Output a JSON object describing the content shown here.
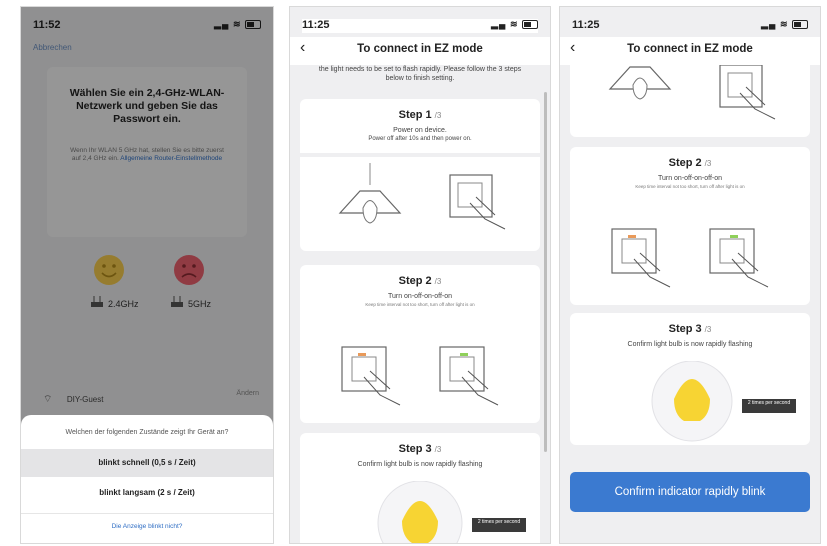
{
  "screens": [
    {
      "status_time": "11:52",
      "top_label": "Abbrechen",
      "card_title": "Wählen Sie ein 2,4-GHz-WLAN-Netzwerk und geben Sie das Passwort ein.",
      "card_hint": "Wenn Ihr WLAN 5 GHz hat, stellen Sie es bitte zuerst auf 2,4 GHz ein.",
      "card_link": "Allgemeine Router-Einstellmethode",
      "band_24": "2.4GHz",
      "band_5": "5GHz",
      "wifi_name": "DIY-Guest",
      "wifi_change": "Ändern",
      "sheet_question": "Welchen der folgenden Zustände zeigt Ihr Gerät an?",
      "options": [
        "blinkt schnell   (0,5 s / Zeit)",
        "blinkt langsam   (2 s / Zeit)"
      ],
      "selected_option": 0,
      "sheet_link": "Die Anzeige blinkt nicht?"
    },
    {
      "status_time": "11:25",
      "title": "To connect in EZ mode",
      "intro": "the light needs to be set to flash rapidly. Please follow the 3 steps below to finish setting.",
      "step1_title": "Step 1",
      "step1_count": "/3",
      "step1_line1": "Power on device.",
      "step1_line2": "Power off after 10s and then power on.",
      "step2_title": "Step 2",
      "step2_count": "/3",
      "step2_line1": "Turn on-off-on-off-on",
      "step2_tiny": "Keep time interval not too short, turn off after light is on",
      "step3_title": "Step 3",
      "step3_count": "/3",
      "step3_line1": "Confirm light bulb is now rapidly flashing",
      "badge": "2 times per second"
    },
    {
      "status_time": "11:25",
      "title": "To connect in EZ mode",
      "step2_title": "Step 2",
      "step2_count": "/3",
      "step2_line1": "Turn on-off-on-off-on",
      "step2_tiny": "Keep time interval not too short, turn off after light is on",
      "step3_title": "Step 3",
      "step3_count": "/3",
      "step3_line1": "Confirm light bulb is now rapidly flashing",
      "badge": "2 times per second",
      "confirm_button": "Confirm indicator rapidly blink"
    }
  ],
  "colors": {
    "accent_blue": "#3b7ad0",
    "bulb_yellow": "#f7d433",
    "switch_orange": "#e99a5a",
    "switch_green": "#8fd05a",
    "happy_face": "#f2c94c",
    "sad_face": "#e8606c"
  },
  "icons": [
    "back-chevron-icon",
    "wifi-icon",
    "battery-icon",
    "signal-icon",
    "router-icon",
    "smiley-icon",
    "sad-face-icon",
    "lamp-icon",
    "wall-switch-icon",
    "bulb-icon"
  ]
}
